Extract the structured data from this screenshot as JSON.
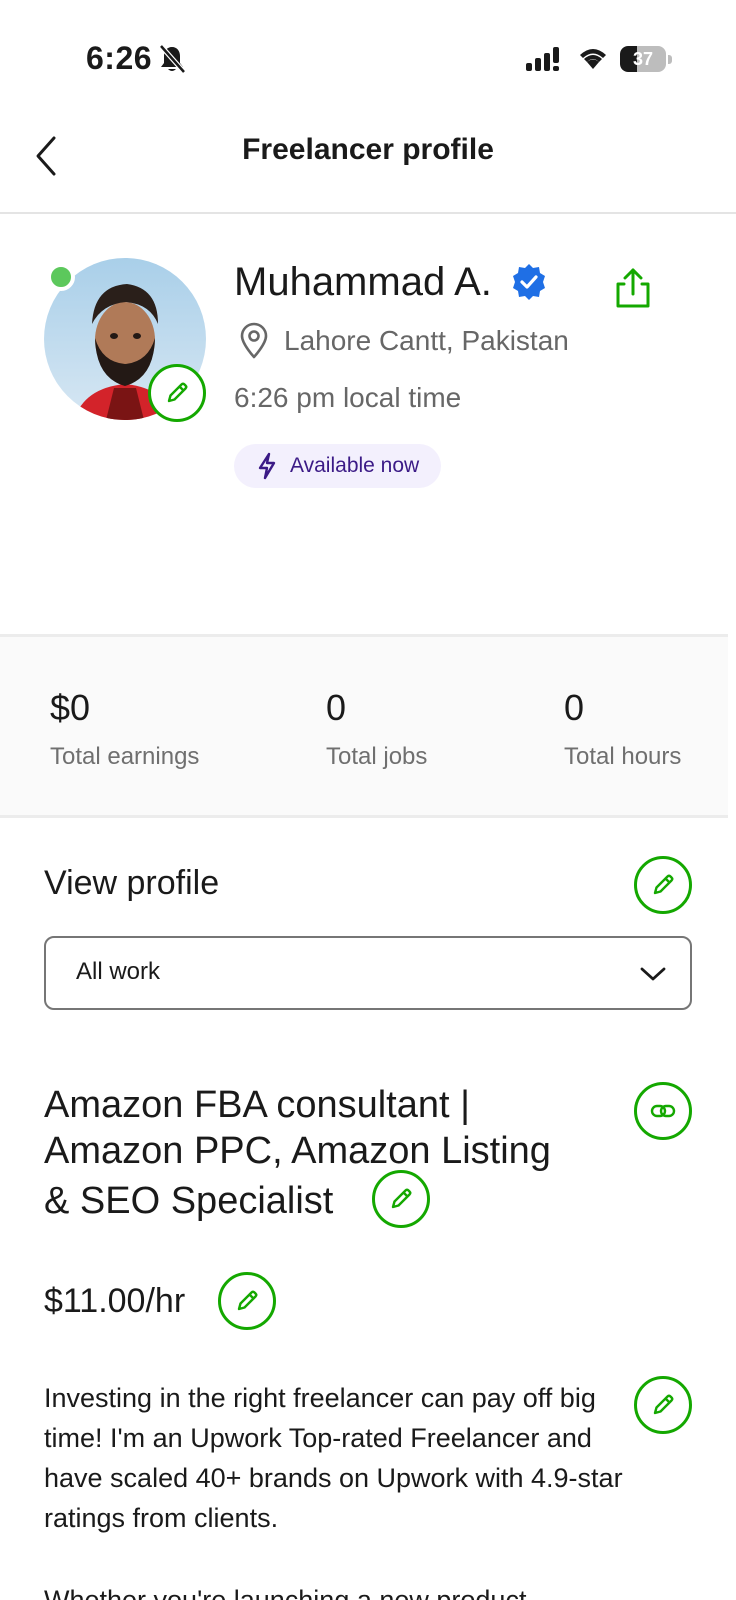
{
  "status_bar": {
    "time": "6:26",
    "battery_level": "37",
    "battery_fraction": 0.37
  },
  "nav": {
    "title": "Freelancer profile",
    "back_icon": "chevron-left-icon"
  },
  "profile": {
    "name": "Muhammad A.",
    "location": "Lahore Cantt, Pakistan",
    "local_time": "6:26 pm local time",
    "availability": "Available now",
    "online": true,
    "verified": true
  },
  "stats": [
    {
      "value": "$0",
      "label": "Total earnings"
    },
    {
      "value": "0",
      "label": "Total jobs"
    },
    {
      "value": "0",
      "label": "Total hours"
    }
  ],
  "view_profile": {
    "title": "View profile",
    "selected": "All work"
  },
  "job": {
    "title_line1": "Amazon FBA consultant |",
    "title_line2": "Amazon PPC, Amazon Listing",
    "title_line3": "& SEO Specialist",
    "rate": "$11.00/hr",
    "description": "Investing in the right freelancer can pay off big time! I'm an Upwork Top-rated Freelancer and have scaled 40+ brands on Upwork with 4.9-star ratings from clients.",
    "description_more": "Whether you're launching a new product"
  },
  "colors": {
    "accent": "#14a800",
    "verified": "#1f6fe5",
    "online": "#5cc85c",
    "availability_bg": "#f3f0fd"
  }
}
